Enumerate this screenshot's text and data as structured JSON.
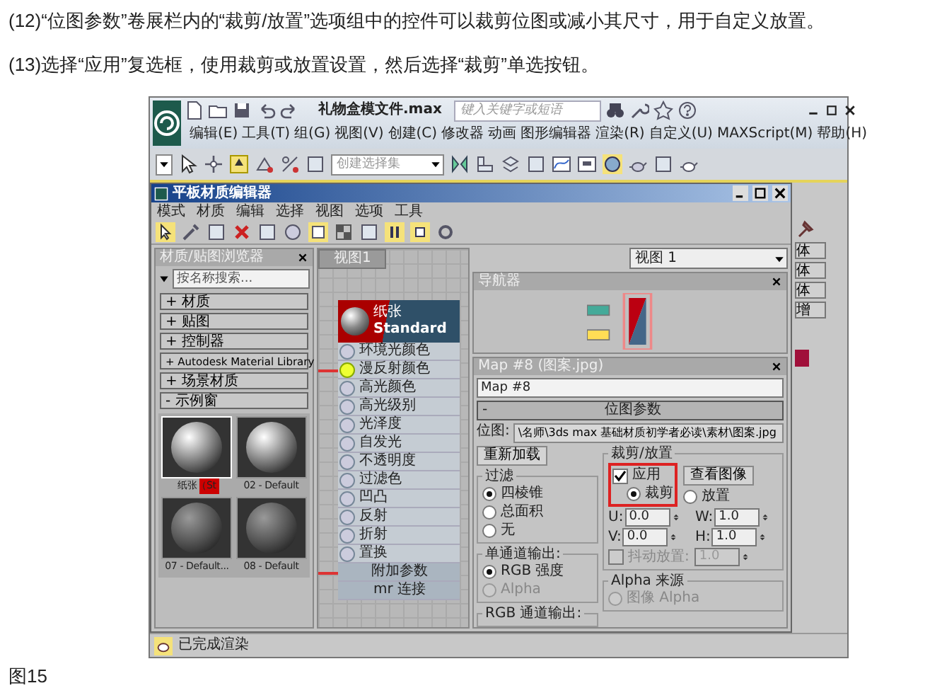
{
  "article": {
    "paragraphs": [
      "(12)“位图参数”卷展栏内的“裁剪/放置”选项组中的控件可以裁剪位图或减小其尺寸，用于自定义放置。",
      "(13)选择“应用”复选框，使用裁剪或放置设置，然后选择“裁剪”单选按钮。"
    ],
    "caption": "图15"
  },
  "app_window": {
    "title": "礼物盒模文件.max",
    "search": {
      "placeholder": "键入关键字或短语"
    },
    "menu": [
      "编辑(E)",
      "工具(T)",
      "组(G)",
      "视图(V)",
      "创建(C)",
      "修改器",
      "动画",
      "图形编辑器",
      "渲染(R)",
      "自定义(U)",
      "MAXScript(M)",
      "帮助(H)"
    ],
    "selection_set": {
      "placeholder": "创建选择集"
    },
    "status_bar": "已完成渲染",
    "command_panel": {
      "buttons": [
        "体",
        "体",
        "体",
        "增"
      ]
    }
  },
  "material_editor": {
    "title": "平板材质编辑器",
    "menu": [
      "模式",
      "材质",
      "编辑",
      "选择",
      "视图",
      "选项",
      "工具"
    ],
    "browser": {
      "title": "材质/贴图浏览器",
      "search": {
        "placeholder": "按名称搜索..."
      },
      "sections": [
        "+ 材质",
        "+ 贴图",
        "+ 控制器",
        "+ Autodesk Material Library",
        "+ 场景材质",
        "- 示例窗"
      ],
      "samples": [
        {
          "label": "纸张（St",
          "selected": true
        },
        {
          "label": "02 - Default",
          "selected": false
        },
        {
          "label": "07 - Default...",
          "selected": false
        },
        {
          "label": "08 - Default",
          "selected": false
        }
      ]
    },
    "view_tab": "视图1",
    "node": {
      "name": "纸张",
      "type": "Standard",
      "slots": [
        {
          "kind": "slot",
          "label": "环境光颜色",
          "connected": false
        },
        {
          "kind": "slot",
          "label": "漫反射颜色",
          "connected": true
        },
        {
          "kind": "slot",
          "label": "高光颜色",
          "connected": false
        },
        {
          "kind": "slot",
          "label": "高光级别",
          "connected": false
        },
        {
          "kind": "slot",
          "label": "光泽度",
          "connected": false
        },
        {
          "kind": "slot",
          "label": "自发光",
          "connected": false
        },
        {
          "kind": "slot",
          "label": "不透明度",
          "connected": false
        },
        {
          "kind": "slot",
          "label": "过滤色",
          "connected": false
        },
        {
          "kind": "slot",
          "label": "凹凸",
          "connected": false
        },
        {
          "kind": "slot",
          "label": "反射",
          "connected": false
        },
        {
          "kind": "slot",
          "label": "折射",
          "connected": false
        },
        {
          "kind": "slot",
          "label": "置换",
          "connected": false
        },
        {
          "kind": "group",
          "label": "附加参数",
          "connected": true
        },
        {
          "kind": "group",
          "label": "mr 连接",
          "connected": false
        }
      ]
    },
    "view_select": "视图 1",
    "navigator": {
      "title": "导航器"
    },
    "map_panel": {
      "title": "Map #8 (图案.jpg)",
      "name_field": "Map #8",
      "rollout": {
        "sign": "-",
        "title": "位图参数"
      },
      "bitmap_label": "位图:",
      "bitmap_path": "\\名师\\3ds max 基础材质初学者必读\\素材\\图案.jpg",
      "reload": "重新加载",
      "filter": {
        "title": "过滤",
        "options": [
          {
            "label": "四棱锥",
            "selected": true,
            "disabled": false
          },
          {
            "label": "总面积",
            "selected": false,
            "disabled": false
          },
          {
            "label": "无",
            "selected": false,
            "disabled": false
          }
        ]
      },
      "mono_output": {
        "title": "单通道输出:",
        "options": [
          {
            "label": "RGB 强度",
            "selected": true,
            "disabled": false
          },
          {
            "label": "Alpha",
            "selected": false,
            "disabled": true
          }
        ]
      },
      "rgb_output": {
        "title": "RGB 通道输出:"
      },
      "crop": {
        "title": "裁剪/放置",
        "highlight": true,
        "apply": {
          "label": "应用",
          "checked": true
        },
        "view_image": "查看图像",
        "modes": [
          {
            "label": "裁剪",
            "selected": true
          },
          {
            "label": "放置",
            "selected": false
          }
        ],
        "fields": [
          {
            "label": "U:",
            "value": "0.0"
          },
          {
            "label": "W:",
            "value": "1.0"
          },
          {
            "label": "V:",
            "value": "0.0"
          },
          {
            "label": "H:",
            "value": "1.0"
          }
        ],
        "jitter": {
          "label": "抖动放置:",
          "checked": false,
          "disabled": true,
          "value": "1.0"
        }
      },
      "alpha_source": {
        "title": "Alpha 来源",
        "options": [
          {
            "label": "图像 Alpha",
            "selected": false,
            "disabled": true
          }
        ]
      }
    }
  }
}
